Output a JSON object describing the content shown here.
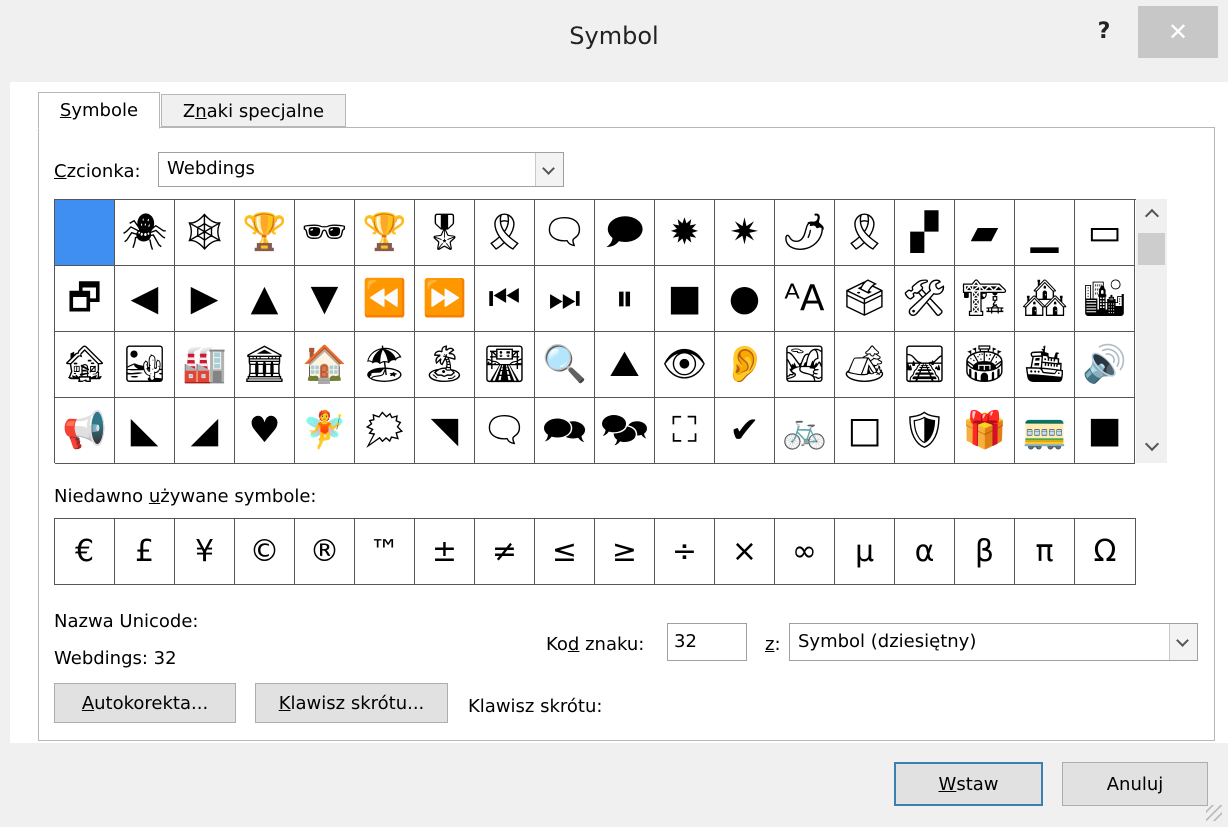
{
  "window": {
    "title": "Symbol",
    "help_label": "?",
    "close_label": "✕"
  },
  "tabs": [
    {
      "label_u": "S",
      "label_rest": "ymbole"
    },
    {
      "label_pre": "Z",
      "label_u": "n",
      "label_rest": "aki specjalne"
    }
  ],
  "font": {
    "label_u": "C",
    "label_rest": "zcionka:",
    "value": "Webdings"
  },
  "symbol_grid": {
    "rows": [
      [
        "",
        "🕷",
        "🕸",
        "🏆",
        "🕶",
        "🏆",
        "🎖",
        "🎗",
        "🗨",
        "🗩",
        "✹",
        "✷",
        "🌶",
        "🎗",
        "▞",
        "▰",
        "▁",
        "▭"
      ],
      [
        "🗗",
        "◀",
        "▶",
        "▲",
        "▼",
        "⏪",
        "⏩",
        "⏮",
        "⏭",
        "⏸",
        "■",
        "●",
        "ᴬA",
        "🗳",
        "🛠",
        "🏗",
        "🏘",
        "🏙"
      ],
      [
        "🏚",
        "🏜",
        "🏭",
        "🏛",
        "🏠",
        "🏖",
        "🏝",
        "🛣",
        "🔍",
        "⛰",
        "👁",
        "👂",
        "🏞",
        "🏕",
        "🛤",
        "🏟",
        "🛳",
        "🔊"
      ],
      [
        "📢",
        "◣",
        "◢",
        "♥",
        "🧚",
        "🗯",
        "◥",
        "🗨",
        "🗪",
        "🗫",
        "⛶",
        "✔",
        "🚲",
        "□",
        "🛡",
        "🎁",
        "🚃",
        "■"
      ]
    ],
    "selected": "0,0"
  },
  "recent": {
    "label_pre": "Niedawno ",
    "label_u": "u",
    "label_rest": "żywane symbole:",
    "symbols": [
      "€",
      "£",
      "¥",
      "©",
      "®",
      "™",
      "±",
      "≠",
      "≤",
      "≥",
      "÷",
      "×",
      "∞",
      "μ",
      "α",
      "β",
      "π",
      "Ω"
    ]
  },
  "unicode": {
    "name_label": "Nazwa Unicode:",
    "name_value": "Webdings: 32"
  },
  "char_code": {
    "label_pre": "Ko",
    "label_u": "d",
    "label_rest": " znaku:",
    "value": "32"
  },
  "from": {
    "label_u": "z",
    "label_rest": ":",
    "value": "Symbol (dziesiętny)"
  },
  "buttons": {
    "autocorrect": {
      "u": "A",
      "rest": "utokorekta..."
    },
    "shortcut_key": {
      "u": "K",
      "rest": "lawisz skrótu..."
    },
    "shortcut_label": "Klawisz skrótu:",
    "insert": {
      "u": "W",
      "rest": "staw"
    },
    "cancel": "Anuluj"
  },
  "colors": {
    "selection": "#3f8ef2",
    "default_button_border": "#3c7fb1"
  }
}
